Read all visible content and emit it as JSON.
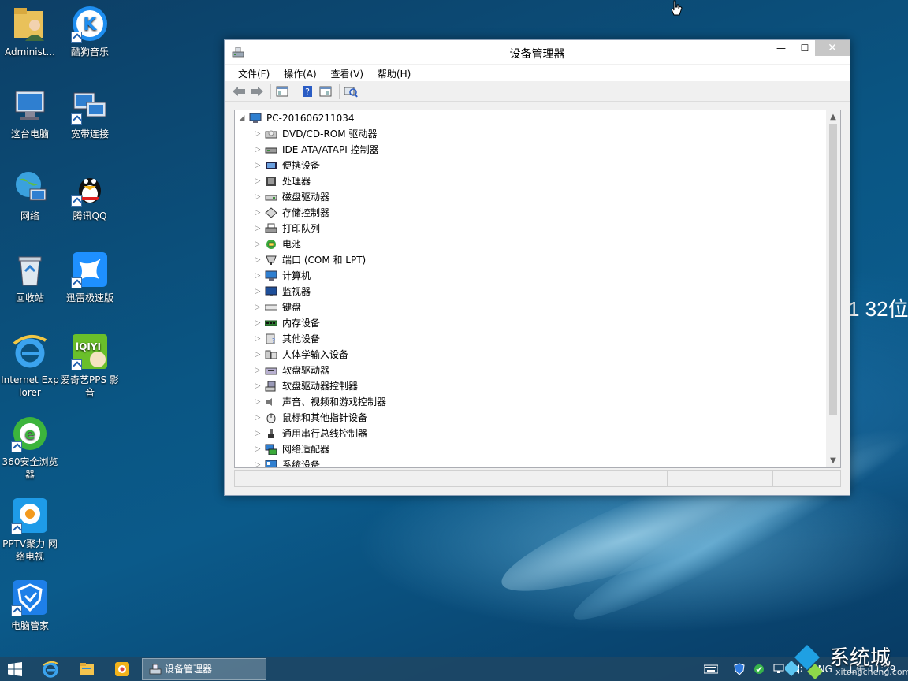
{
  "desktop": {
    "bg_text": "1 32位",
    "icons": [
      {
        "label": "Administ...",
        "icon": "user-folder-icon"
      },
      {
        "label": "酷狗音乐",
        "icon": "kugou-icon"
      },
      {
        "label": "这台电脑",
        "icon": "computer-icon"
      },
      {
        "label": "宽带连接",
        "icon": "broadband-icon"
      },
      {
        "label": "网络",
        "icon": "network-icon"
      },
      {
        "label": "腾讯QQ",
        "icon": "qq-icon"
      },
      {
        "label": "回收站",
        "icon": "recycle-bin-icon"
      },
      {
        "label": "迅雷极速版",
        "icon": "xunlei-icon"
      },
      {
        "label": "Internet Explorer",
        "icon": "ie-icon"
      },
      {
        "label": "爱奇艺PPS 影音",
        "icon": "iqiyi-icon"
      },
      {
        "label": "360安全浏览器",
        "icon": "360-browser-icon"
      },
      {
        "label": "PPTV聚力 网络电视",
        "icon": "pptv-icon"
      },
      {
        "label": "电脑管家",
        "icon": "pc-manager-icon"
      }
    ]
  },
  "window": {
    "title": "设备管理器",
    "controls": {
      "minimize": "—",
      "maximize": "☐",
      "close": "✕"
    },
    "menu": [
      "文件(F)",
      "操作(A)",
      "查看(V)",
      "帮助(H)"
    ],
    "toolbar": [
      "back-icon",
      "forward-icon",
      "properties-icon",
      "help-icon",
      "view-icon",
      "scan-hardware-icon"
    ],
    "tree": {
      "root": {
        "label": "PC-201606211034",
        "expander": "◢",
        "icon": "computer-icon"
      },
      "items": [
        {
          "label": "DVD/CD-ROM 驱动器",
          "icon": "dvd-drive-icon"
        },
        {
          "label": "IDE ATA/ATAPI 控制器",
          "icon": "ide-controller-icon"
        },
        {
          "label": "便携设备",
          "icon": "portable-device-icon"
        },
        {
          "label": "处理器",
          "icon": "processor-icon"
        },
        {
          "label": "磁盘驱动器",
          "icon": "disk-drive-icon"
        },
        {
          "label": "存储控制器",
          "icon": "storage-controller-icon"
        },
        {
          "label": "打印队列",
          "icon": "printer-icon"
        },
        {
          "label": "电池",
          "icon": "battery-icon"
        },
        {
          "label": "端口 (COM 和 LPT)",
          "icon": "port-icon"
        },
        {
          "label": "计算机",
          "icon": "computer-icon"
        },
        {
          "label": "监视器",
          "icon": "monitor-icon"
        },
        {
          "label": "键盘",
          "icon": "keyboard-icon"
        },
        {
          "label": "内存设备",
          "icon": "memory-icon"
        },
        {
          "label": "其他设备",
          "icon": "other-device-icon"
        },
        {
          "label": "人体学输入设备",
          "icon": "hid-icon"
        },
        {
          "label": "软盘驱动器",
          "icon": "floppy-drive-icon"
        },
        {
          "label": "软盘驱动器控制器",
          "icon": "floppy-controller-icon"
        },
        {
          "label": "声音、视频和游戏控制器",
          "icon": "sound-icon"
        },
        {
          "label": "鼠标和其他指针设备",
          "icon": "mouse-icon"
        },
        {
          "label": "通用串行总线控制器",
          "icon": "usb-icon"
        },
        {
          "label": "网络适配器",
          "icon": "network-adapter-icon"
        },
        {
          "label": "系统设备",
          "icon": "system-device-icon"
        }
      ],
      "expander": "▷"
    },
    "scroll": {
      "up": "▲",
      "down": "▼"
    }
  },
  "taskbar": {
    "start_icon": "windows-start-icon",
    "pinned": [
      "ie-icon",
      "file-explorer-icon",
      "qq-browser-icon"
    ],
    "active_app": {
      "label": "设备管理器",
      "icon": "device-manager-icon"
    },
    "tray": {
      "lang": "ENG",
      "time": "上午 11:29"
    }
  },
  "watermark": {
    "text": "系统城",
    "sub": "xitongcheng.com"
  }
}
